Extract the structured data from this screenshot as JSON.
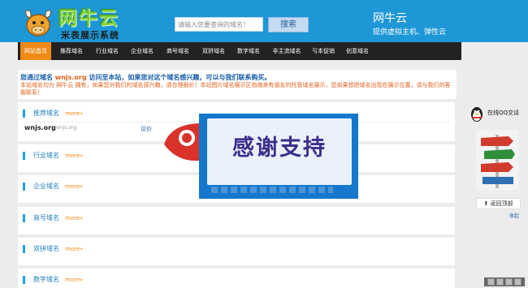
{
  "header": {
    "logo_title": "网牛云",
    "logo_subtitle": "米表展示系统",
    "search_placeholder": "请输入您要查询的域名！",
    "search_button": "搜索",
    "brand_name": "网牛云",
    "brand_tagline": "提供虚拟主机、弹性云"
  },
  "nav": {
    "items": [
      {
        "label": "网站首页",
        "active": true
      },
      {
        "label": "推荐域名"
      },
      {
        "label": "行业域名"
      },
      {
        "label": "企业域名"
      },
      {
        "label": "商号域名"
      },
      {
        "label": "双拼域名"
      },
      {
        "label": "数字域名"
      },
      {
        "label": "非主流域名"
      },
      {
        "label": "亏本促销"
      },
      {
        "label": "创意域名"
      }
    ]
  },
  "notice": {
    "line1_prefix": "您通过域名",
    "line1_domain": "wnjs.org",
    "line1_suffix": "访问至本站，如果您对这个域名感兴趣，可以与我们联系购买。",
    "line2": "本站域名均为 网牛云 拥有，如果您对我们的域名感兴趣，请合理报价！本站图片域名展示区指南来有朋友的托管域名展示，您如果想把域名出现在展示位置，请与我们的客服联系！"
  },
  "sections": [
    {
      "title": "推荐域名",
      "more": "more»",
      "domains": [
        {
          "name": "wnjs.org",
          "sub": "wnjs.org",
          "price": "议价"
        }
      ]
    },
    {
      "title": "行业域名",
      "more": "more»"
    },
    {
      "title": "企业域名",
      "more": "more»"
    },
    {
      "title": "商号域名",
      "more": "more»"
    },
    {
      "title": "双拼域名",
      "more": "more»"
    },
    {
      "title": "数字域名",
      "more": "more»"
    }
  ],
  "sidebar": {
    "qq_label": "在线QQ交谈",
    "back_top": "返回顶部",
    "collapse": "收起"
  },
  "popup": {
    "text": "感谢支持"
  },
  "colors": {
    "header_bg": "#1d97d6",
    "nav_bg": "#222222",
    "nav_active": "#ef8a15",
    "accent_blue": "#22a0e2",
    "more_orange": "#ef8a15"
  }
}
